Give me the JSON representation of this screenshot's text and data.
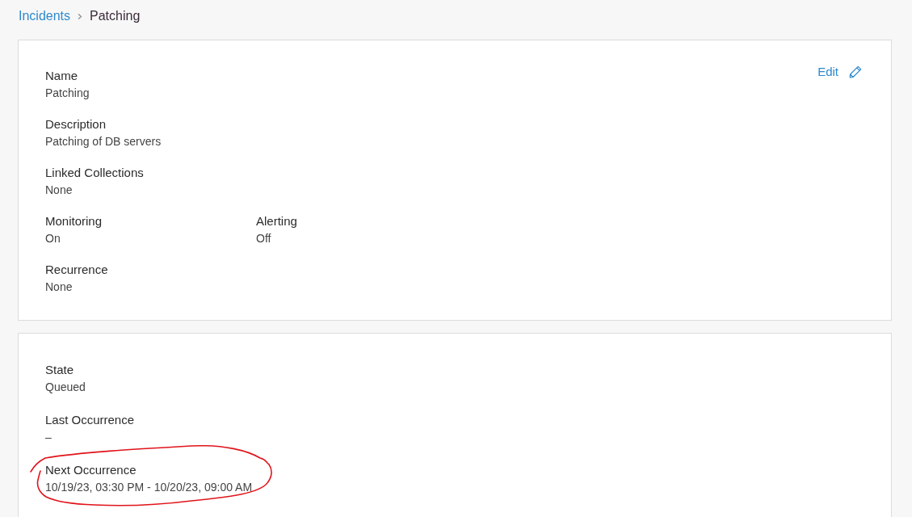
{
  "breadcrumb": [
    {
      "label": "Incidents",
      "kind": "link"
    },
    {
      "label": "Patching",
      "kind": "current"
    }
  ],
  "details_card": {
    "edit_button": {
      "label": "Edit"
    },
    "rows": [
      {
        "fields": [
          {
            "label": "Name",
            "value": "Patching"
          }
        ]
      },
      {
        "fields": [
          {
            "label": "Description",
            "value": "Patching of DB servers"
          }
        ]
      },
      {
        "fields": [
          {
            "label": "Linked Collections",
            "value": "None"
          }
        ]
      },
      {
        "fields": [
          {
            "label": "Monitoring",
            "value": "On"
          },
          {
            "label": "Alerting",
            "value": "Off"
          }
        ]
      },
      {
        "fields": [
          {
            "label": "Recurrence",
            "value": "None"
          }
        ]
      }
    ]
  },
  "status_card": {
    "rows": [
      {
        "fields": [
          {
            "label": "State",
            "value": "Queued"
          }
        ]
      },
      {
        "fields": [
          {
            "label": "Last Occurrence",
            "value": "–"
          }
        ]
      },
      {
        "fields": [
          {
            "label": "Next Occurrence",
            "value": "10/19/23, 03:30 PM - 10/20/23, 09:00 AM"
          }
        ]
      }
    ]
  }
}
